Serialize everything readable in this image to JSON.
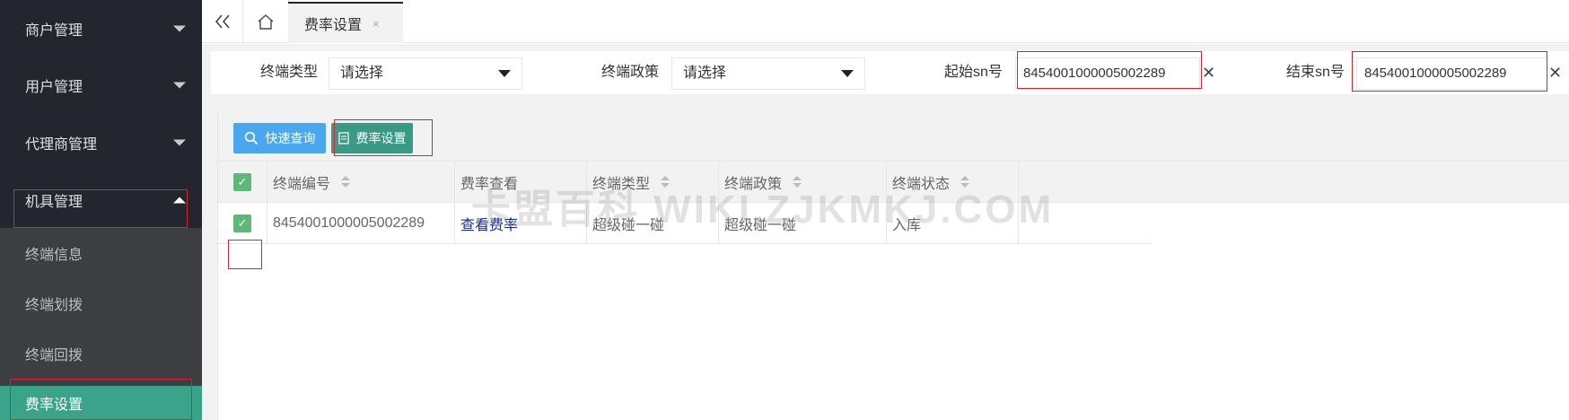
{
  "sidebar": {
    "menu": [
      {
        "label": "商户管理"
      },
      {
        "label": "用户管理"
      },
      {
        "label": "代理商管理"
      },
      {
        "label": "机具管理"
      }
    ],
    "submenu": [
      {
        "label": "终端信息"
      },
      {
        "label": "终端划拨"
      },
      {
        "label": "终端回拨"
      },
      {
        "label": "费率设置",
        "active": true
      }
    ]
  },
  "tabs": {
    "active_label": "费率设置",
    "close_glyph": "×"
  },
  "filters": {
    "terminal_type_label": "终端类型",
    "terminal_type_value": "请选择",
    "terminal_policy_label": "终端政策",
    "terminal_policy_value": "请选择",
    "start_sn_label": "起始sn号",
    "start_sn_value": "8454001000005002289",
    "end_sn_label": "结束sn号",
    "end_sn_value": "8454001000005002289"
  },
  "toolbar": {
    "quick_query_label": "快速查询",
    "rate_setting_label": "费率设置"
  },
  "table": {
    "columns": [
      "终端编号",
      "费率查看",
      "终端类型",
      "终端政策",
      "终端状态"
    ],
    "rows": [
      {
        "terminal_no": "8454001000005002289",
        "rate_view": "查看费率",
        "terminal_type": "超级碰一碰",
        "terminal_policy": "超级碰一碰",
        "status": "入库"
      }
    ]
  },
  "watermark": "卡盟百科  WIKI.ZJKMKJ.COM",
  "colors": {
    "sidebar_bg": "#23262e",
    "submenu_bg": "#3d3e42",
    "active_green": "#3aa38a",
    "query_blue": "#4aa7ee",
    "checkbox_green": "#5fb878",
    "highlight_red": "#d9232e"
  },
  "icons": {
    "collapse": "double-chevron-left-icon",
    "home": "home-icon",
    "search": "search-icon",
    "document": "document-icon",
    "clear": "close-icon",
    "check": "check-icon"
  }
}
